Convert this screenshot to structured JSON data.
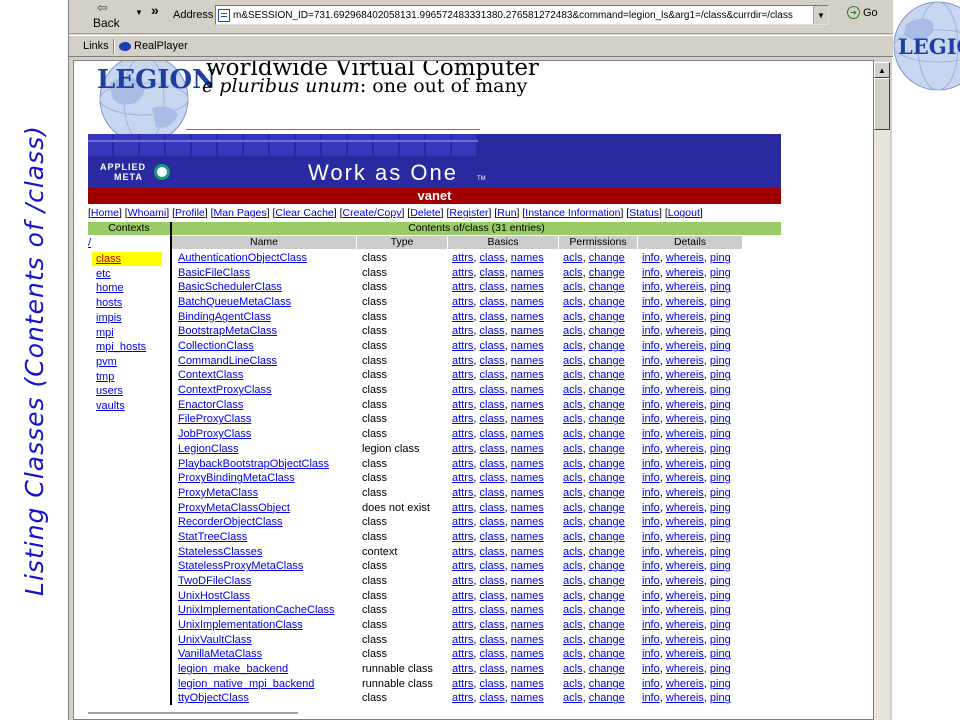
{
  "slide": {
    "title": "Listing Classes (Contents of /class)"
  },
  "browser": {
    "back_label": "Back",
    "address_label": "Address",
    "address_value": "m&SESSION_ID=731.692968402058131.996572483331380.276581272483&command=legion_ls&arg1=/class&currdir=/class",
    "go_label": "Go",
    "links_label": "Links",
    "realplayer_label": "RealPlayer"
  },
  "banner": {
    "logo_text": "LEGION",
    "title": "worldwide Virtual Computer",
    "subtitle_em": "e pluribus unum",
    "subtitle_rest": ": one out of many",
    "applied_meta_line1": "APPLIED",
    "applied_meta_line2": "META",
    "motto": "Work as One",
    "tm": "TM",
    "context_name": "vanet"
  },
  "menu": [
    "Home",
    "Whoami",
    "Profile",
    "Man Pages",
    "Clear Cache",
    "Create/Copy",
    "Delete",
    "Register",
    "Run",
    "Instance Information",
    "Status",
    "Logout"
  ],
  "contexts": {
    "header": "Contexts",
    "root": "/",
    "items": [
      "class",
      "etc",
      "home",
      "hosts",
      "impis",
      "mpi",
      "mpi_hosts",
      "pvm",
      "tmp",
      "users",
      "vaults"
    ],
    "selected": "class"
  },
  "contents": {
    "header": "Contents of/class (31 entries)",
    "columns": [
      "Name",
      "Type",
      "Basics",
      "Permissions",
      "Details"
    ],
    "basics_links": [
      "attrs",
      "class",
      "names"
    ],
    "permission_links": [
      "acls",
      "change"
    ],
    "detail_links": [
      "info",
      "whereis",
      "ping"
    ],
    "rows": [
      {
        "name": "AuthenticationObjectClass",
        "type": "class"
      },
      {
        "name": "BasicFileClass",
        "type": "class"
      },
      {
        "name": "BasicSchedulerClass",
        "type": "class"
      },
      {
        "name": "BatchQueueMetaClass",
        "type": "class"
      },
      {
        "name": "BindingAgentClass",
        "type": "class"
      },
      {
        "name": "BootstrapMetaClass",
        "type": "class"
      },
      {
        "name": "CollectionClass",
        "type": "class"
      },
      {
        "name": "CommandLineClass",
        "type": "class"
      },
      {
        "name": "ContextClass",
        "type": "class"
      },
      {
        "name": "ContextProxyClass",
        "type": "class"
      },
      {
        "name": "EnactorClass",
        "type": "class"
      },
      {
        "name": "FileProxyClass",
        "type": "class"
      },
      {
        "name": "JobProxyClass",
        "type": "class"
      },
      {
        "name": "LegionClass",
        "type": "legion class"
      },
      {
        "name": "PlaybackBootstrapObjectClass",
        "type": "class"
      },
      {
        "name": "ProxyBindingMetaClass",
        "type": "class"
      },
      {
        "name": "ProxyMetaClass",
        "type": "class"
      },
      {
        "name": "ProxyMetaClassObject",
        "type": "does not exist"
      },
      {
        "name": "RecorderObjectClass",
        "type": "class"
      },
      {
        "name": "StatTreeClass",
        "type": "class"
      },
      {
        "name": "StatelessClasses",
        "type": "context"
      },
      {
        "name": "StatelessProxyMetaClass",
        "type": "class"
      },
      {
        "name": "TwoDFileClass",
        "type": "class"
      },
      {
        "name": "UnixHostClass",
        "type": "class"
      },
      {
        "name": "UnixImplementationCacheClass",
        "type": "class"
      },
      {
        "name": "UnixImplementationClass",
        "type": "class"
      },
      {
        "name": "UnixVaultClass",
        "type": "class"
      },
      {
        "name": "VanillaMetaClass",
        "type": "class"
      },
      {
        "name": "legion_make_backend",
        "type": "runnable class"
      },
      {
        "name": "legion_native_mpi_backend",
        "type": "runnable class"
      },
      {
        "name": "ttyObjectClass",
        "type": "class"
      }
    ]
  },
  "colors": {
    "slide_title": "#1414c8",
    "link": "#0000ee",
    "header_green": "#99cc66",
    "banner_blue": "#2a2aa0",
    "context_red": "#a00000",
    "selected_bg": "#ffff00"
  }
}
